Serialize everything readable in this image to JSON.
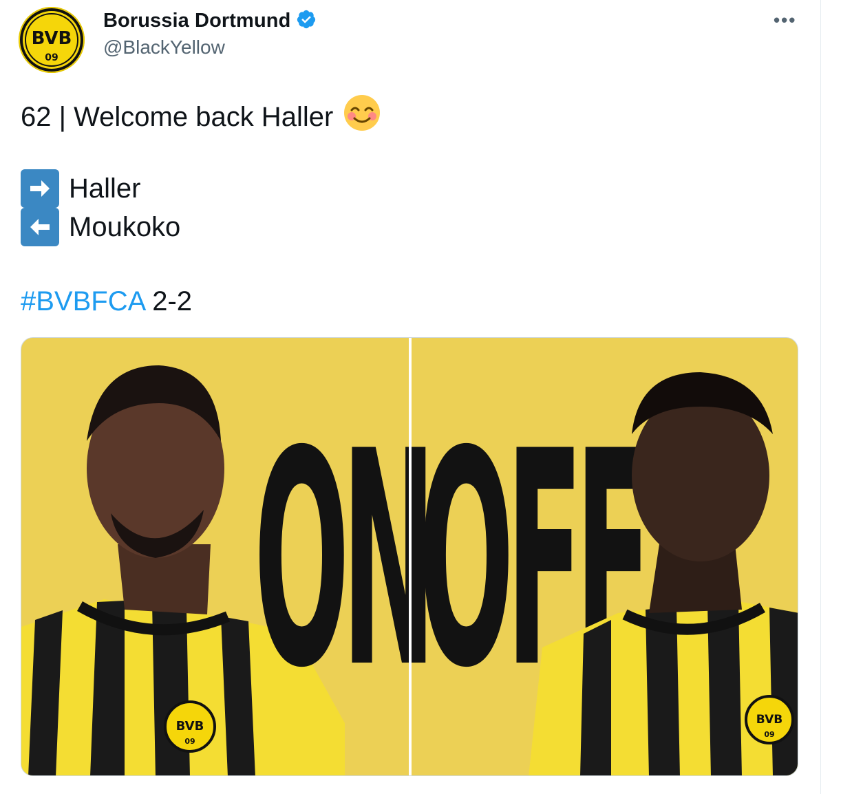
{
  "account": {
    "display_name": "Borussia Dortmund",
    "handle": "@BlackYellow",
    "verified": true,
    "avatar_logo_top": "BVB",
    "avatar_logo_bottom": "09"
  },
  "more_menu": {
    "label": "•••",
    "icon": "more-horizontal-icon"
  },
  "tweet": {
    "line1": "62 | Welcome back Haller",
    "line1_emoji": "smiling-face-with-smiling-eyes",
    "sub_in": {
      "icon": "right-arrow-icon",
      "name": "Haller"
    },
    "sub_out": {
      "icon": "left-arrow-icon",
      "name": "Moukoko"
    },
    "hashtag": "#BVBFCA",
    "score": "2-2"
  },
  "media": {
    "left_panel": {
      "word": "ON",
      "player": "Haller",
      "crest_top": "BVB",
      "crest_bottom": "09"
    },
    "right_panel": {
      "word": "OFF",
      "player": "Moukoko",
      "crest_top": "BVB",
      "crest_bottom": "09"
    },
    "background_color": "#ecd055"
  },
  "colors": {
    "link": "#1d9bf0",
    "verified": "#1d9bf0",
    "secondary_text": "#536471",
    "brand_yellow": "#f5d60a"
  }
}
